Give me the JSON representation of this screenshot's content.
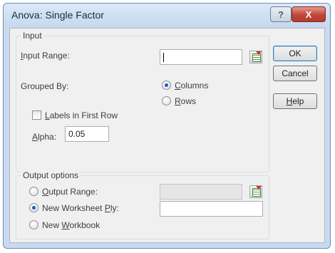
{
  "dialog": {
    "title": "Anova: Single Factor",
    "titlebar_help": "?",
    "titlebar_close": "X"
  },
  "input": {
    "group_label": "Input",
    "input_range_label_pre": "",
    "input_range_label_ul": "I",
    "input_range_label_post": "nput Range:",
    "input_range_value": "",
    "grouped_by_label": "Grouped By:",
    "columns_ul": "C",
    "columns_post": "olumns",
    "rows_ul": "R",
    "rows_post": "ows",
    "grouped_by_selected": "Columns",
    "labels_ul": "L",
    "labels_post": "abels in First Row",
    "labels_checked": false,
    "alpha_ul": "A",
    "alpha_post": "lpha:",
    "alpha_value": "0.05"
  },
  "output": {
    "group_label": "Output options",
    "output_range_ul": "O",
    "output_range_post": "utput Range:",
    "output_range_value": "",
    "new_ply_pre": "New Worksheet ",
    "new_ply_ul": "P",
    "new_ply_post": "ly:",
    "new_ply_value": "",
    "new_workbook_pre": "New ",
    "new_workbook_ul": "W",
    "new_workbook_post": "orkbook",
    "selected": "New Worksheet Ply"
  },
  "buttons": {
    "ok": "OK",
    "cancel": "Cancel",
    "help_ul": "H",
    "help_post": "elp"
  },
  "icons": {
    "range_selector": "range-selector-icon",
    "close": "close-icon",
    "help": "help-icon"
  }
}
